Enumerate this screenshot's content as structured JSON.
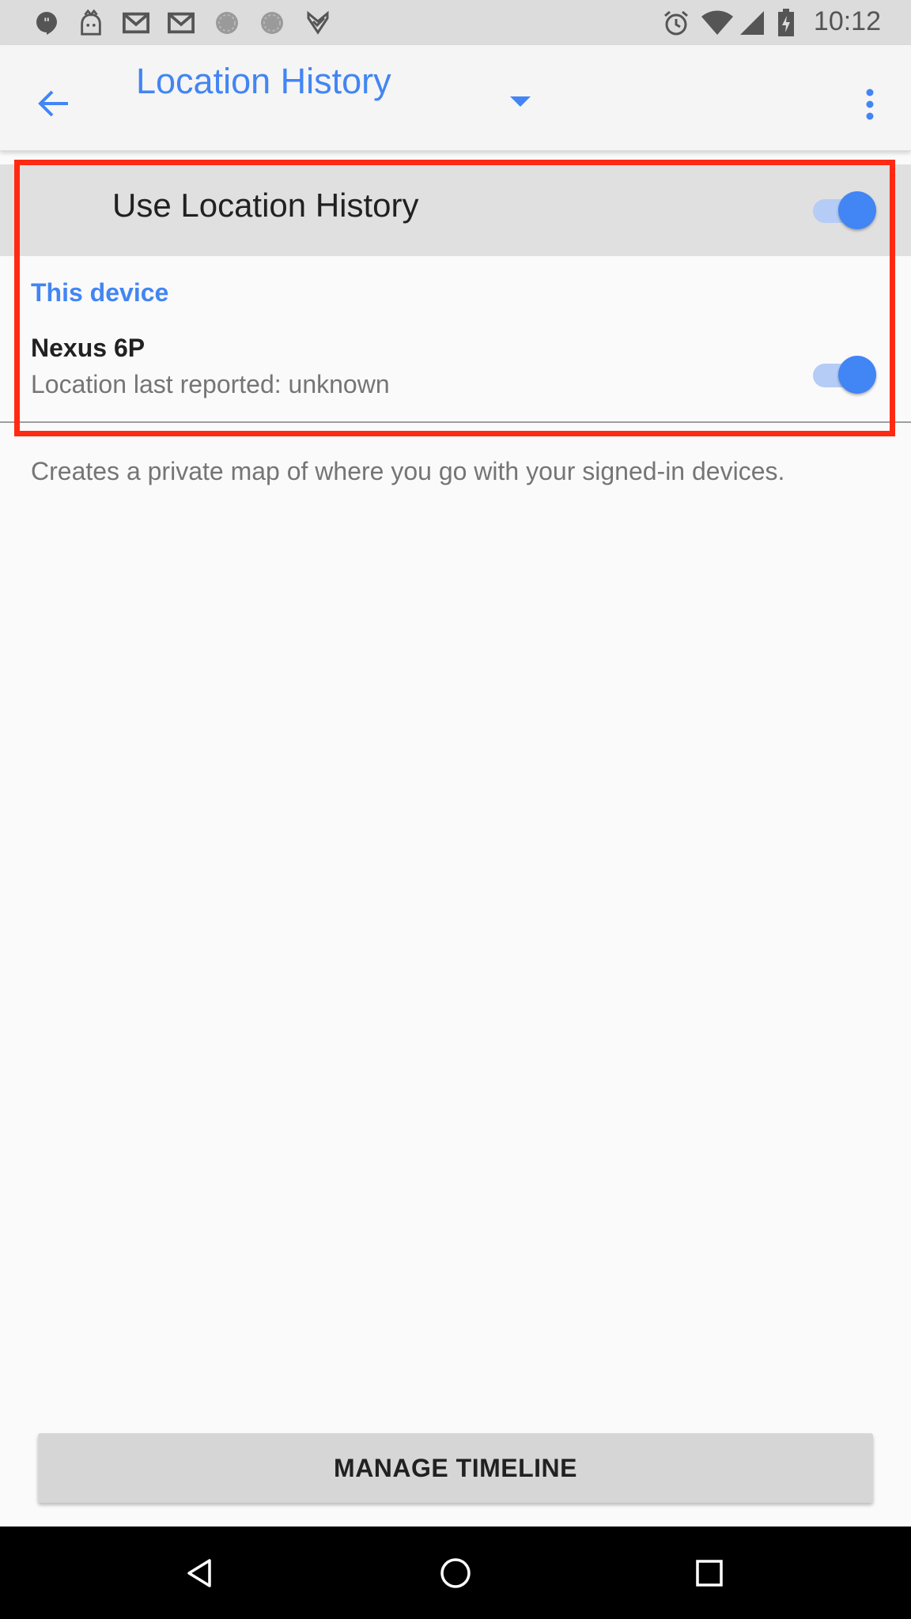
{
  "status_bar": {
    "time": "10:12",
    "left_icons": [
      "hangouts-icon",
      "game-app-icon",
      "gmail-icon",
      "gmail-icon",
      "gray-circle-icon",
      "gray-circle-icon",
      "checkmark-app-icon"
    ],
    "right_icons": [
      "alarm-icon",
      "wifi-icon",
      "cell-signal-icon",
      "battery-icon"
    ]
  },
  "app_bar": {
    "title": "Location History",
    "back_icon": "back-arrow-icon",
    "dropdown_icon": "dropdown-arrow-icon",
    "more_icon": "more-vert-icon"
  },
  "master_switch": {
    "label": "Use Location History",
    "enabled": true
  },
  "devices_section": {
    "header": "This device",
    "device": {
      "name": "Nexus 6P",
      "status": "Location last reported: unknown",
      "enabled": true
    }
  },
  "description": "Creates a private map of where you go with your signed-in devices.",
  "manage_button": {
    "label": "MANAGE TIMELINE"
  },
  "nav_bar": {
    "buttons": [
      "back-triangle-icon",
      "home-circle-icon",
      "recents-square-icon"
    ]
  },
  "colors": {
    "accent": "#4285f4",
    "highlight": "#ff2a12",
    "toggle_track": "#b5ccf7",
    "master_row_bg": "#e0e0e0"
  }
}
